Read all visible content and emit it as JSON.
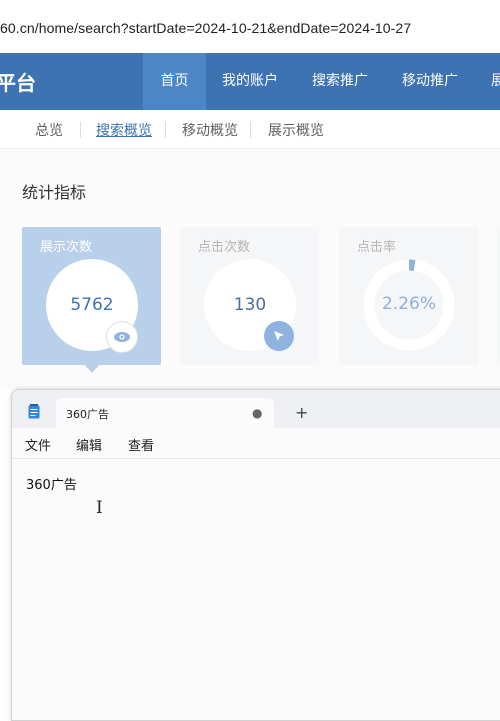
{
  "browser": {
    "url": "60.cn/home/search?startDate=2024-10-21&endDate=2024-10-27"
  },
  "header": {
    "brand": "平台",
    "nav": [
      {
        "label": "首页",
        "active": true
      },
      {
        "label": "我的账户",
        "active": false
      },
      {
        "label": "搜索推广",
        "active": false
      },
      {
        "label": "移动推广",
        "active": false
      },
      {
        "label": "展",
        "active": false
      }
    ]
  },
  "subnav": [
    {
      "label": "总览"
    },
    {
      "label": "搜索概览"
    },
    {
      "label": "移动概览"
    },
    {
      "label": "展示概览"
    }
  ],
  "stats": {
    "title": "统计指标",
    "cards": [
      {
        "label": "展示次数",
        "value": "5762",
        "icon": "eye-icon"
      },
      {
        "label": "点击次数",
        "value": "130",
        "icon": "cursor-arrow-icon"
      },
      {
        "label": "点击率",
        "value": "2.26%",
        "icon": "ring-progress"
      }
    ]
  },
  "notepad": {
    "tab_title": "360广告",
    "tab_modified": "●",
    "new_tab": "+",
    "menu": [
      "文件",
      "编辑",
      "查看"
    ],
    "content": "360广告",
    "cursor": "I"
  },
  "colors": {
    "nav_bg": "#3d73b3",
    "nav_active": "#4d86c7",
    "active_card": "#b9d0ea",
    "link": "#3d73b3"
  }
}
